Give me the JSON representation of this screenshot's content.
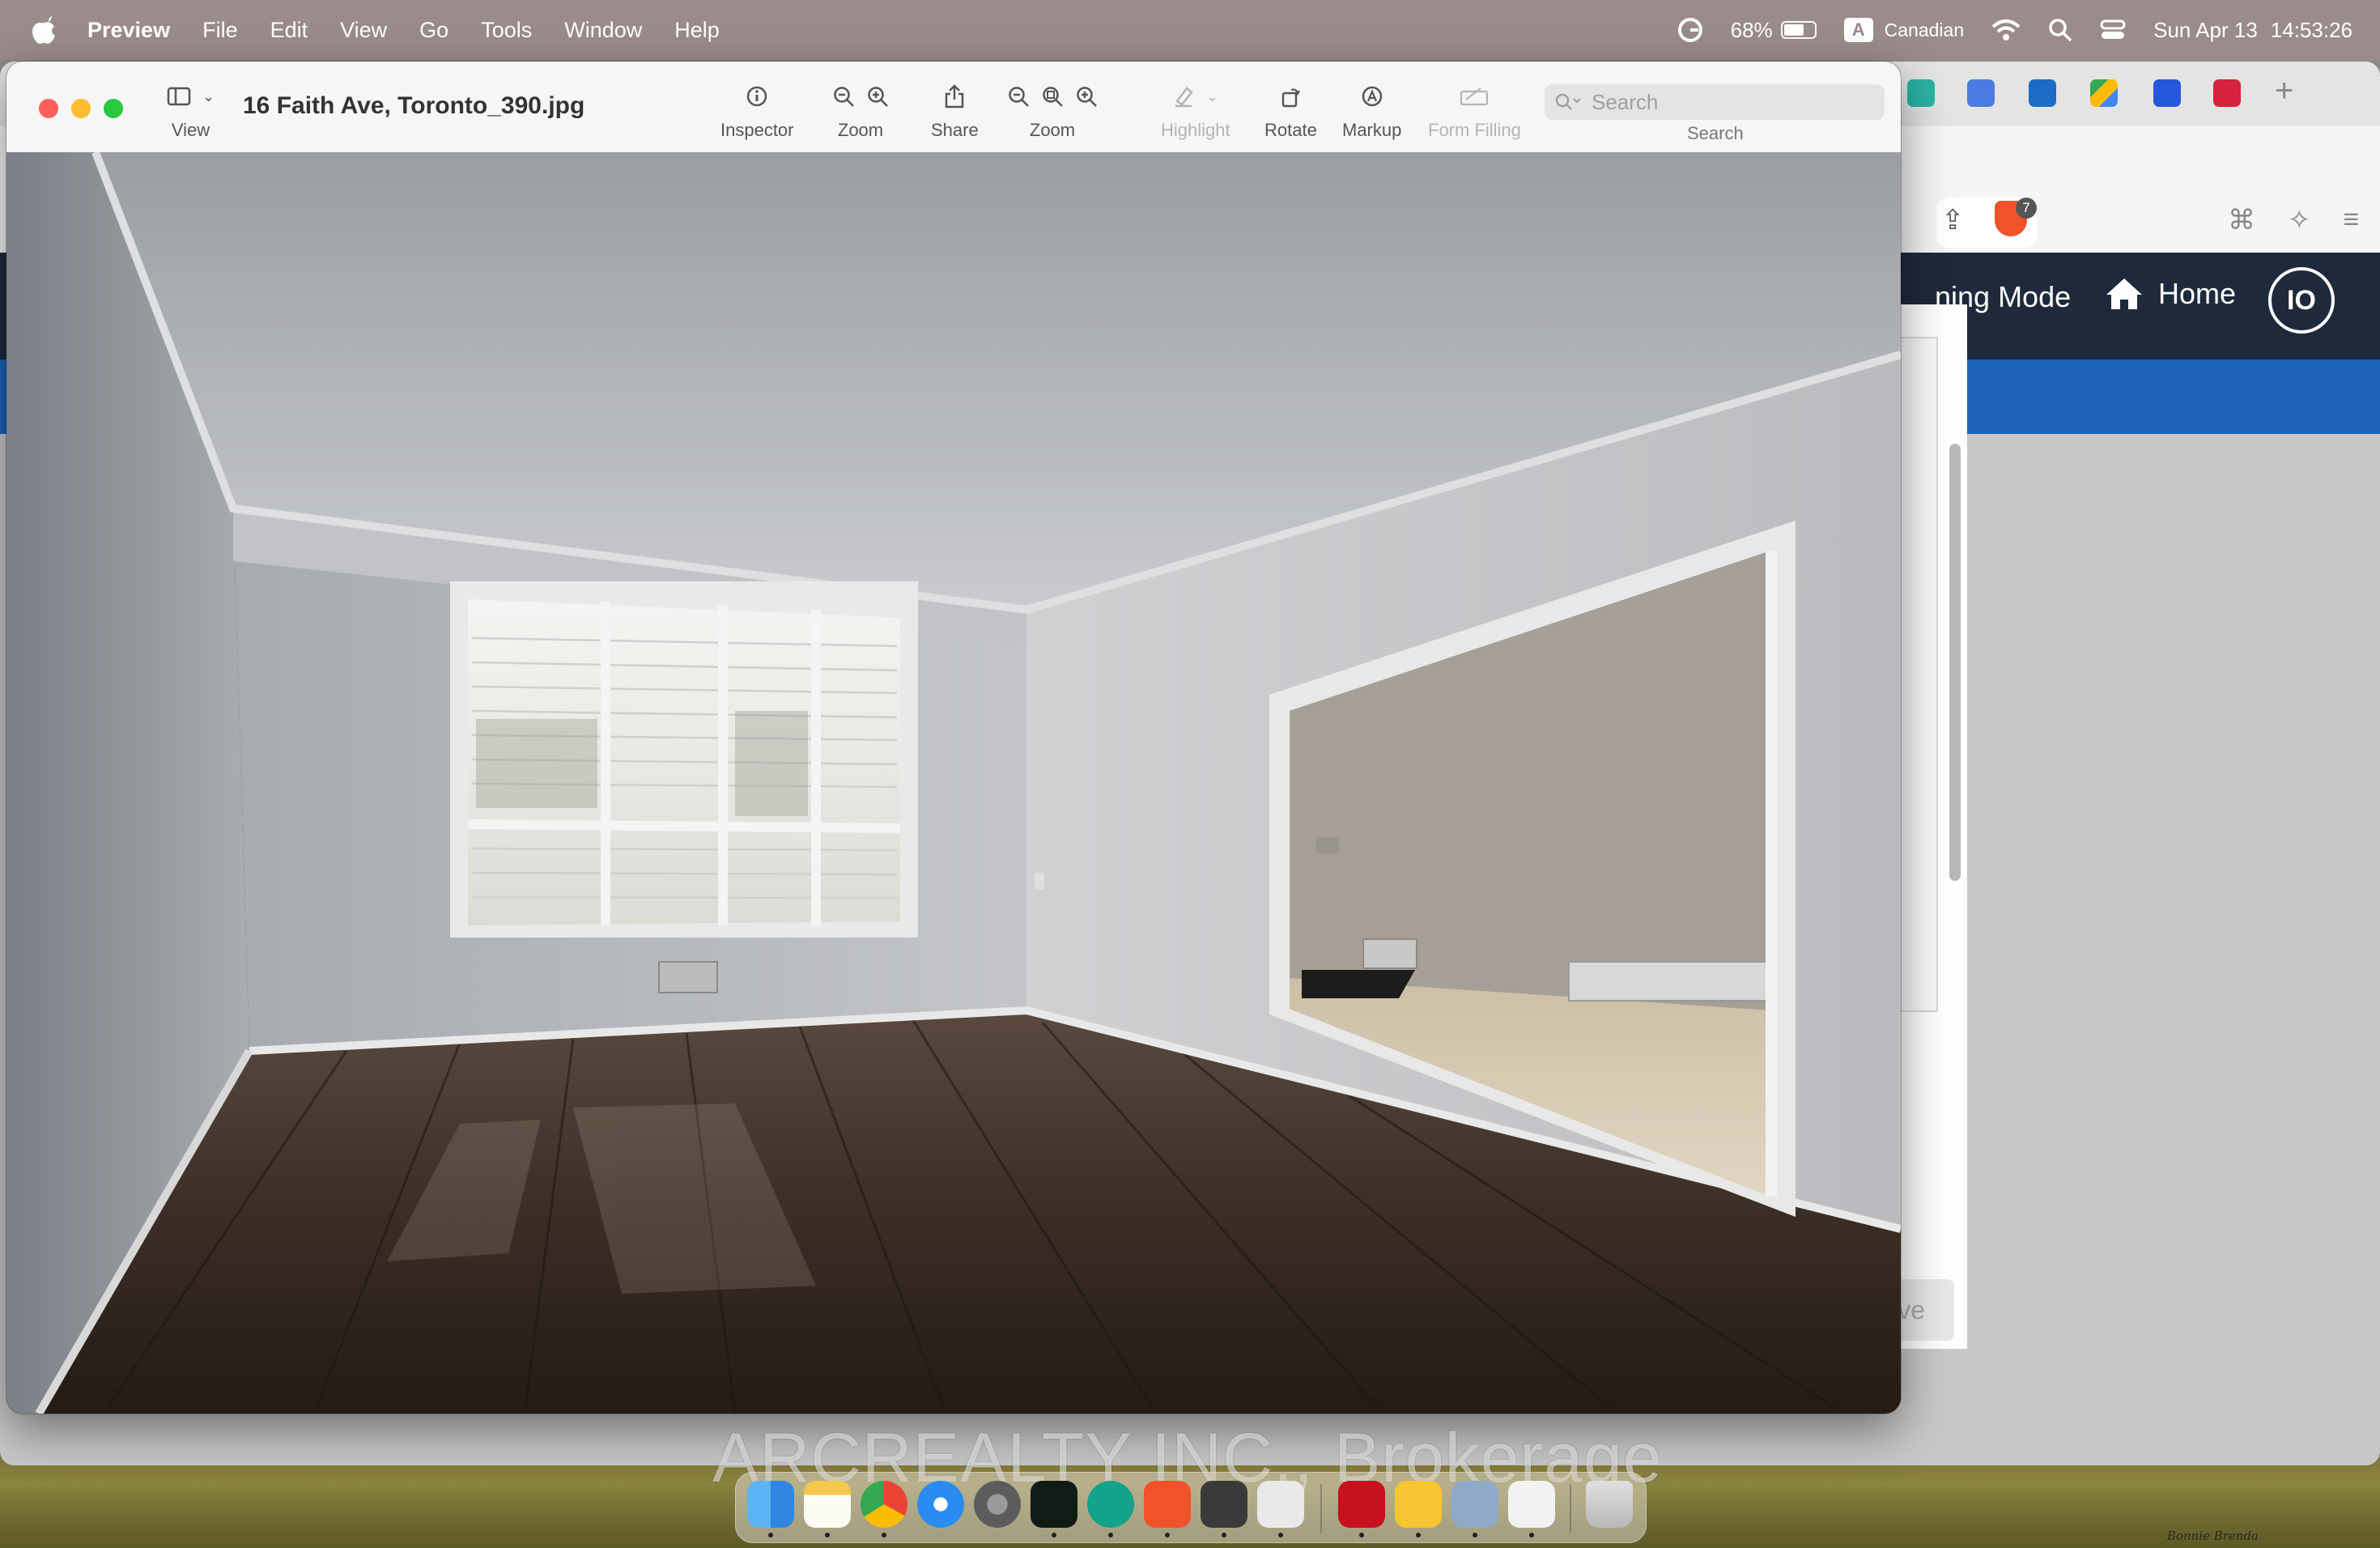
{
  "menubar": {
    "apple_icon": "apple-logo-icon",
    "app_name": "Preview",
    "menus": [
      "File",
      "Edit",
      "View",
      "Go",
      "Tools",
      "Window",
      "Help"
    ],
    "battery_percent": "68%",
    "battery_level": 0.68,
    "input_source_letter": "A",
    "input_source": "Canadian",
    "date": "Sun Apr 13",
    "time": "14:53:26"
  },
  "preview": {
    "title": "16 Faith Ave, Toronto_390.jpg",
    "toolbar": {
      "view": "View",
      "inspector": "Inspector",
      "zoom1": "Zoom",
      "share": "Share",
      "zoom2": "Zoom",
      "highlight": "Highlight",
      "rotate": "Rotate",
      "markup": "Markup",
      "form_filling": "Form Filling",
      "search_label": "Search",
      "search_placeholder": "Search"
    }
  },
  "browser": {
    "mode_fragment": "ning Mode",
    "home_label": "Home",
    "avatar_initials": "IO",
    "save_fragment": "ve",
    "brave_count": "7"
  },
  "watermark": "ARCREALTY INC., Brokerage",
  "wallpaper_signature": "Bonnie Brenda",
  "colors": {
    "menubar": "#9a8c8a",
    "site_header": "#1e2a3c",
    "site_blue": "#1d62b6",
    "traffic_red": "#fe5f57",
    "traffic_yellow": "#febc2e",
    "traffic_green": "#28c840"
  }
}
